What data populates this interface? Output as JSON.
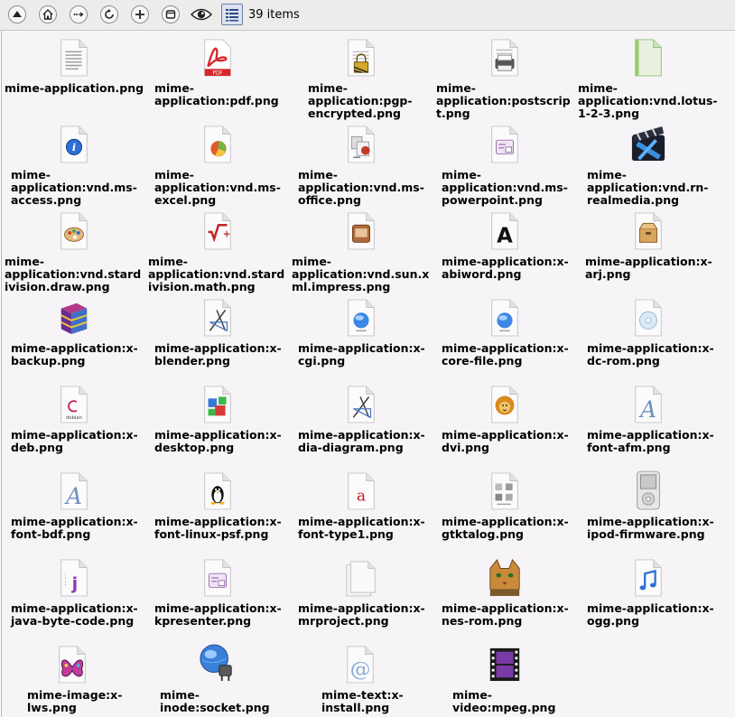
{
  "toolbar": {
    "buttons": [
      {
        "name": "up-button",
        "icon": "up-arrow-icon"
      },
      {
        "name": "home-button",
        "icon": "home-icon"
      },
      {
        "name": "go-button",
        "icon": "dots-arrow-icon"
      },
      {
        "name": "refresh-button",
        "icon": "refresh-icon"
      },
      {
        "name": "new-folder-button",
        "icon": "plus-icon"
      },
      {
        "name": "window-button",
        "icon": "window-icon"
      },
      {
        "name": "show-hidden-button",
        "icon": "eye-icon"
      },
      {
        "name": "view-mode-button",
        "icon": "list-icon"
      }
    ],
    "item_count": "39 items"
  },
  "files": [
    {
      "name": "mime-application.png",
      "label": "mime-application.png",
      "icon": "text-document-icon"
    },
    {
      "name": "mime-application:pdf.png",
      "label": "mime-\napplication:pdf.png",
      "icon": "pdf-icon"
    },
    {
      "name": "mime-application:pgp-encrypted.png",
      "label": "mime-\napplication:pgp-\nencrypted.png",
      "icon": "encrypted-document-icon"
    },
    {
      "name": "mime-application:postscript.png",
      "label": "mime-\napplication:postscrip\nt.png",
      "icon": "printer-document-icon"
    },
    {
      "name": "mime-application:vnd.lotus-1-2-3.png",
      "label": "mime-\napplication:vnd.lotus-\n1-2-3.png",
      "icon": "green-document-icon"
    },
    {
      "name": "mime-application:vnd.ms-access.png",
      "label": "mime-\napplication:vnd.ms-\naccess.png",
      "icon": "access-database-icon"
    },
    {
      "name": "mime-application:vnd.ms-excel.png",
      "label": "mime-\napplication:vnd.ms-\nexcel.png",
      "icon": "spreadsheet-chart-icon"
    },
    {
      "name": "mime-application:vnd.ms-office.png",
      "label": "mime-\napplication:vnd.ms-\noffice.png",
      "icon": "office-documents-icon"
    },
    {
      "name": "mime-application:vnd.ms-powerpoint.png",
      "label": "mime-\napplication:vnd.ms-\npowerpoint.png",
      "icon": "presentation-document-icon"
    },
    {
      "name": "mime-application:vnd.rn-realmedia.png",
      "label": "mime-\napplication:vnd.rn-\nrealmedia.png",
      "icon": "clapperboard-icon"
    },
    {
      "name": "mime-application:vnd.stardivision.draw.png",
      "label": "mime-\napplication:vnd.stard\nivision.draw.png",
      "icon": "palette-document-icon"
    },
    {
      "name": "mime-application:vnd.stardivision.math.png",
      "label": "mime-\napplication:vnd.stard\nivision.math.png",
      "icon": "math-formula-icon"
    },
    {
      "name": "mime-application:vnd.sun.xml.impress.png",
      "label": "mime-\napplication:vnd.sun.x\nml.impress.png",
      "icon": "impress-document-icon"
    },
    {
      "name": "mime-application:x-abiword.png",
      "label": "mime-application:x-\nabiword.png",
      "icon": "abiword-letter-a-icon"
    },
    {
      "name": "mime-application:x-arj.png",
      "label": "mime-application:x-\narj.png",
      "icon": "archive-box-icon"
    },
    {
      "name": "mime-application:x-backup.png",
      "label": "mime-application:x-\nbackup.png",
      "icon": "rar-books-icon"
    },
    {
      "name": "mime-application:x-blender.png",
      "label": "mime-application:x-\nblender.png",
      "icon": "drafting-tools-icon"
    },
    {
      "name": "mime-application:x-cgi.png",
      "label": "mime-application:x-\ncgi.png",
      "icon": "blue-orb-document-icon"
    },
    {
      "name": "mime-application:x-core-file.png",
      "label": "mime-application:x-\ncore-file.png",
      "icon": "blue-orb-document-icon"
    },
    {
      "name": "mime-application:x-dc-rom.png",
      "label": "mime-application:x-\ndc-rom.png",
      "icon": "disc-document-icon"
    },
    {
      "name": "mime-application:x-deb.png",
      "label": "mime-application:x-\ndeb.png",
      "icon": "debian-package-icon"
    },
    {
      "name": "mime-application:x-desktop.png",
      "label": "mime-application:x-\ndesktop.png",
      "icon": "desktop-shapes-icon"
    },
    {
      "name": "mime-application:x-dia-diagram.png",
      "label": "mime-application:x-\ndia-diagram.png",
      "icon": "drafting-tools-icon"
    },
    {
      "name": "mime-application:x-dvi.png",
      "label": "mime-application:x-\ndvi.png",
      "icon": "lion-document-icon"
    },
    {
      "name": "mime-application:x-font-afm.png",
      "label": "mime-application:x-\nfont-afm.png",
      "icon": "font-letter-a-icon"
    },
    {
      "name": "mime-application:x-font-bdf.png",
      "label": "mime-application:x-\nfont-bdf.png",
      "icon": "font-letter-a-icon"
    },
    {
      "name": "mime-application:x-font-linux-psf.png",
      "label": "mime-application:x-\nfont-linux-psf.png",
      "icon": "tux-penguin-icon"
    },
    {
      "name": "mime-application:x-font-type1.png",
      "label": "mime-application:x-\nfont-type1.png",
      "icon": "red-letter-a-icon"
    },
    {
      "name": "mime-application:x-gtktalog.png",
      "label": "mime-application:x-\ngtktalog.png",
      "icon": "catalog-document-icon"
    },
    {
      "name": "mime-application:x-ipod-firmware.png",
      "label": "mime-application:x-\nipod-firmware.png",
      "icon": "ipod-icon"
    },
    {
      "name": "mime-application:x-java-byte-code.png",
      "label": "mime-application:x-\njava-byte-code.png",
      "icon": "java-letter-j-icon"
    },
    {
      "name": "mime-application:x-kpresenter.png",
      "label": "mime-application:x-\nkpresenter.png",
      "icon": "presentation-document-icon"
    },
    {
      "name": "mime-application:x-mrproject.png",
      "label": "mime-application:x-\nmrproject.png",
      "icon": "stacked-documents-icon"
    },
    {
      "name": "mime-application:x-nes-rom.png",
      "label": "mime-application:x-\nnes-rom.png",
      "icon": "cat-picture-icon"
    },
    {
      "name": "mime-application:x-ogg.png",
      "label": "mime-application:x-\nogg.png",
      "icon": "music-note-icon"
    },
    {
      "name": "mime-image:x-lws.png",
      "label": "mime-image:x-\nlws.png",
      "icon": "butterfly-image-icon"
    },
    {
      "name": "mime-inode:socket.png",
      "label": "mime-\ninode:socket.png",
      "icon": "globe-plug-icon"
    },
    {
      "name": "mime-text:x-install.png",
      "label": "mime-text:x-\ninstall.png",
      "icon": "at-sign-document-icon"
    },
    {
      "name": "mime-video:mpeg.png",
      "label": "mime-\nvideo:mpeg.png",
      "icon": "film-strip-icon"
    }
  ]
}
